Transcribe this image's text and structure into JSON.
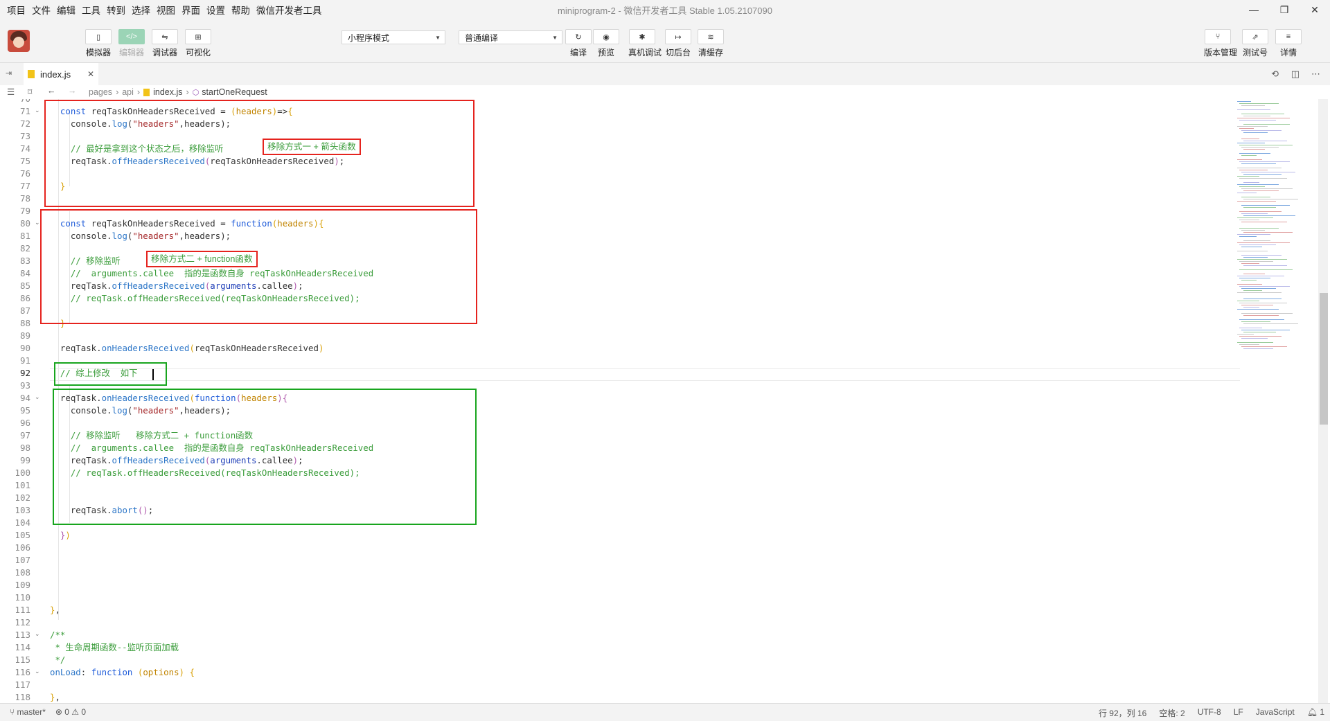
{
  "menu": [
    "项目",
    "文件",
    "编辑",
    "工具",
    "转到",
    "选择",
    "视图",
    "界面",
    "设置",
    "帮助",
    "微信开发者工具"
  ],
  "window_title": "miniprogram-2 - 微信开发者工具 Stable 1.05.2107090",
  "window_controls": {
    "minimize": "—",
    "maximize": "❐",
    "close": "✕"
  },
  "toolbar": {
    "left_buttons": [
      {
        "label": "模拟器",
        "icon": "phone-icon",
        "glyph": "▯",
        "active": false
      },
      {
        "label": "编辑器",
        "icon": "code-icon",
        "glyph": "</>",
        "active": true
      },
      {
        "label": "调试器",
        "icon": "debugger-icon",
        "glyph": "⇋",
        "active": false
      },
      {
        "label": "可视化",
        "icon": "visual-icon",
        "glyph": "⊞",
        "active": false
      }
    ],
    "mode_select": "小程序模式",
    "compile_select": "普通编译",
    "mid_buttons": [
      {
        "label": "编译",
        "icon": "refresh-icon",
        "glyph": "↻"
      },
      {
        "label": "预览",
        "icon": "eye-icon",
        "glyph": "◉"
      },
      {
        "label": "真机调试",
        "icon": "bug-icon",
        "glyph": "✱"
      },
      {
        "label": "切后台",
        "icon": "switch-icon",
        "glyph": "↦"
      },
      {
        "label": "清缓存",
        "icon": "layers-icon",
        "glyph": "≋"
      }
    ],
    "right_buttons": [
      {
        "label": "版本管理",
        "icon": "branch-icon",
        "glyph": "⑂"
      },
      {
        "label": "测试号",
        "icon": "external-icon",
        "glyph": "⇗"
      },
      {
        "label": "详情",
        "icon": "menu-icon",
        "glyph": "≡"
      }
    ]
  },
  "tab": {
    "name": "index.js",
    "close": "✕"
  },
  "breadcrumb": [
    "pages",
    "api",
    "index.js",
    "startOneRequest"
  ],
  "code_lines": [
    {
      "n": "70",
      "html": ""
    },
    {
      "n": "71",
      "html": "  <span class='kw'>const</span> reqTaskOnHeadersReceived = <span class='br1'>(</span><span class='pa'>headers</span><span class='br1'>)</span>=&gt;<span class='br1'>{</span>",
      "fold": true
    },
    {
      "n": "72",
      "html": "    console.<span class='fn'>log</span>(<span class='str'>\"headers\"</span>,headers);"
    },
    {
      "n": "73",
      "html": ""
    },
    {
      "n": "74",
      "html": "    <span class='cm'>// 最好是拿到这个状态之后，移除监听</span>"
    },
    {
      "n": "75",
      "html": "    reqTask.<span class='fn'>offHeadersReceived</span><span class='br2'>(</span>reqTaskOnHeadersReceived<span class='br2'>)</span>;"
    },
    {
      "n": "76",
      "html": ""
    },
    {
      "n": "77",
      "html": "  <span class='br1'>}</span>"
    },
    {
      "n": "78",
      "html": ""
    },
    {
      "n": "79",
      "html": ""
    },
    {
      "n": "80",
      "html": "  <span class='kw'>const</span> reqTaskOnHeadersReceived = <span class='kw'>function</span><span class='br1'>(</span><span class='pa'>headers</span><span class='br1'>){</span>",
      "fold": true
    },
    {
      "n": "81",
      "html": "    console.<span class='fn'>log</span>(<span class='str'>\"headers\"</span>,headers);"
    },
    {
      "n": "82",
      "html": ""
    },
    {
      "n": "83",
      "html": "    <span class='cm'>// 移除监听</span>"
    },
    {
      "n": "84",
      "html": "    <span class='cm'>//  arguments.callee  指的是函数自身 reqTaskOnHeadersReceived</span>"
    },
    {
      "n": "85",
      "html": "    reqTask.<span class='fn'>offHeadersReceived</span><span class='br2'>(</span><span class='ar'>arguments</span>.callee<span class='br2'>)</span>;"
    },
    {
      "n": "86",
      "html": "    <span class='cm'>// reqTask.offHeadersReceived(reqTaskOnHeadersReceived);</span>"
    },
    {
      "n": "87",
      "html": ""
    },
    {
      "n": "88",
      "html": "  <span class='br1'>}</span>"
    },
    {
      "n": "89",
      "html": ""
    },
    {
      "n": "90",
      "html": "  reqTask.<span class='fn'>onHeadersReceived</span><span class='br1'>(</span>reqTaskOnHeadersReceived<span class='br1'>)</span>"
    },
    {
      "n": "91",
      "html": ""
    },
    {
      "n": "92",
      "html": "  <span class='cm'>// 综上修改  如下</span>",
      "current": true
    },
    {
      "n": "93",
      "html": ""
    },
    {
      "n": "94",
      "html": "  reqTask.<span class='fn'>onHeadersReceived</span><span class='br1'>(</span><span class='kw'>function</span><span class='br2'>(</span><span class='pa'>headers</span><span class='br2'>){</span>",
      "fold": true
    },
    {
      "n": "95",
      "html": "    console.<span class='fn'>log</span>(<span class='str'>\"headers\"</span>,headers);"
    },
    {
      "n": "96",
      "html": ""
    },
    {
      "n": "97",
      "html": "    <span class='cm'>// 移除监听   移除方式二 + function函数</span>"
    },
    {
      "n": "98",
      "html": "    <span class='cm'>//  arguments.callee  指的是函数自身 reqTaskOnHeadersReceived</span>"
    },
    {
      "n": "99",
      "html": "    reqTask.<span class='fn'>offHeadersReceived</span><span class='br2'>(</span><span class='ar'>arguments</span>.callee<span class='br2'>)</span>;"
    },
    {
      "n": "100",
      "html": "    <span class='cm'>// reqTask.offHeadersReceived(reqTaskOnHeadersReceived);</span>"
    },
    {
      "n": "101",
      "html": ""
    },
    {
      "n": "102",
      "html": ""
    },
    {
      "n": "103",
      "html": "    reqTask.<span class='fn'>abort</span><span class='br2'>()</span>;"
    },
    {
      "n": "104",
      "html": ""
    },
    {
      "n": "105",
      "html": "  <span class='br2'>}</span><span class='br1'>)</span>"
    },
    {
      "n": "106",
      "html": ""
    },
    {
      "n": "107",
      "html": ""
    },
    {
      "n": "108",
      "html": ""
    },
    {
      "n": "109",
      "html": ""
    },
    {
      "n": "110",
      "html": ""
    },
    {
      "n": "111",
      "html": "<span class='br1'>}</span>,"
    },
    {
      "n": "112",
      "html": ""
    },
    {
      "n": "113",
      "html": "<span class='cm'>/**</span>",
      "fold": true
    },
    {
      "n": "114",
      "html": "<span class='cm'> * 生命周期函数--监听页面加载</span>"
    },
    {
      "n": "115",
      "html": "<span class='cm'> */</span>"
    },
    {
      "n": "116",
      "html": "<span class='fn'>onLoad</span>: <span class='kw'>function</span> <span class='br1'>(</span><span class='pa'>options</span><span class='br1'>)</span> <span class='br1'>{</span>",
      "fold": true
    },
    {
      "n": "117",
      "html": ""
    },
    {
      "n": "118",
      "html": "<span class='br1'>}</span>,"
    }
  ],
  "annotations": [
    {
      "text": "移除方式一 + 箭头函数"
    },
    {
      "text": "移除方式二 + function函数"
    }
  ],
  "status": {
    "branch": "master*",
    "problems": "⊗ 0 ⚠ 0",
    "position": "行 92，列 16",
    "indent": "空格: 2",
    "encoding": "UTF-8",
    "eol": "LF",
    "language": "JavaScript",
    "notifications": "1"
  },
  "colors": {
    "red_box": "#e5231e",
    "green_box": "#18a51e",
    "comment": "#3a9c3a",
    "keyword": "#1e5bd9",
    "string": "#a5282a"
  }
}
